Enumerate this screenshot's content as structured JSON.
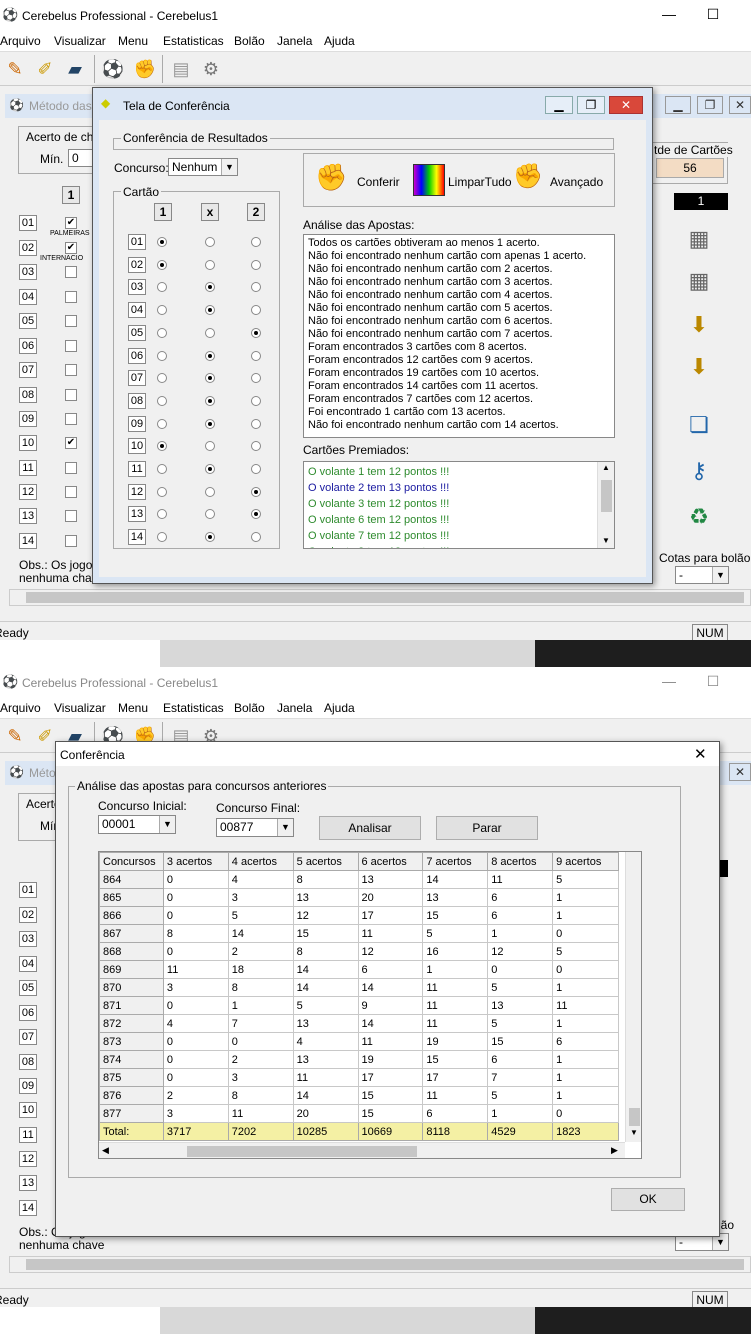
{
  "app": {
    "title": "Cerebelus Professional - Cerebelus1",
    "menu": [
      "Arquivo",
      "Visualizar",
      "Menu",
      "Estatisticas",
      "Bolão",
      "Janela",
      "Ajuda"
    ],
    "child_window_title": "Método das",
    "status_left": "Ready",
    "status_num": "NUM",
    "acerto_label": "Acerto de cha",
    "min_label": "Mín.",
    "min_value": "0",
    "qtde_cartoes_label": "tde de Cartões",
    "qtde_cartoes_value": "56",
    "black_box_value": "1",
    "cotas_label": "Cotas para bolão",
    "cotas_value": "-",
    "obs_line1": "Obs.: Os jogos",
    "obs_line2": "nenhuma chave",
    "col1": "1",
    "rows": [
      "01",
      "02",
      "03",
      "04",
      "05",
      "06",
      "07",
      "08",
      "09",
      "10",
      "11",
      "12",
      "13",
      "14"
    ],
    "team_labels": [
      "PALMEIRAS",
      "INTERNACIO"
    ]
  },
  "dialog1": {
    "title": "Tela de Conferência",
    "group_title": "Conferência de Resultados",
    "concurso_label": "Concurso:",
    "concurso_value": "Nenhum",
    "cartao_label": "Cartão",
    "col_headers": [
      "1",
      "x",
      "2"
    ],
    "rows": [
      "01",
      "02",
      "03",
      "04",
      "05",
      "06",
      "07",
      "08",
      "09",
      "10",
      "11",
      "12",
      "13",
      "14"
    ],
    "selections": [
      0,
      0,
      1,
      1,
      2,
      1,
      1,
      1,
      1,
      0,
      1,
      2,
      2,
      1
    ],
    "btn_conferir": "Conferir",
    "btn_limpar": "LimparTudo",
    "btn_avancado": "Avançado",
    "analise_label": "Análise das Apostas:",
    "analise_lines": [
      "Todos os cartões obtiveram ao menos 1 acerto.",
      "Não foi encontrado nenhum cartão com apenas 1 acerto.",
      "Não foi encontrado nenhum cartão com 2 acertos.",
      "Não foi encontrado nenhum cartão com 3 acertos.",
      "Não foi encontrado nenhum cartão com 4 acertos.",
      "Não foi encontrado nenhum cartão com 5 acertos.",
      "Não foi encontrado nenhum cartão com 6 acertos.",
      "Não foi encontrado nenhum cartão com 7 acertos.",
      "Foram encontrados 3 cartões com 8 acertos.",
      "Foram encontrados 12 cartões com 9 acertos.",
      "Foram encontrados 19 cartões com 10 acertos.",
      "Foram encontrados 14 cartões com 11 acertos.",
      "Foram encontrados 7 cartões com 12 acertos.",
      "Foi encontrado 1 cartão com 13 acertos.",
      "Não foi encontrado nenhum cartão com 14 acertos."
    ],
    "premiados_label": "Cartões Premiados:",
    "premiados": [
      {
        "text": "O volante 1 tem 12 pontos !!!",
        "color": "#2e8b2e"
      },
      {
        "text": "O volante 2 tem 13 pontos !!!",
        "color": "#1a1aa0"
      },
      {
        "text": "O volante 3 tem 12 pontos !!!",
        "color": "#2e8b2e"
      },
      {
        "text": "O volante 6 tem 12 pontos !!!",
        "color": "#2e8b2e"
      },
      {
        "text": "O volante 7 tem 12 pontos !!!",
        "color": "#2e8b2e"
      },
      {
        "text": "O volante 8 tem 12 pontos !!!",
        "color": "#2e8b2e"
      }
    ]
  },
  "dialog2": {
    "title": "Conferência",
    "close": "✕",
    "group_title": "Análise das apostas para concursos anteriores",
    "inicial_label": "Concurso Inicial:",
    "inicial_value": "00001",
    "final_label": "Concurso Final:",
    "final_value": "00877",
    "btn_analisar": "Analisar",
    "btn_parar": "Parar",
    "btn_ok": "OK",
    "columns": [
      "Concursos",
      "3 acertos",
      "4 acertos",
      "5 acertos",
      "6 acertos",
      "7 acertos",
      "8 acertos",
      "9 acertos"
    ],
    "rows": [
      [
        "864",
        "0",
        "4",
        "8",
        "13",
        "14",
        "11",
        "5"
      ],
      [
        "865",
        "0",
        "3",
        "13",
        "20",
        "13",
        "6",
        "1"
      ],
      [
        "866",
        "0",
        "5",
        "12",
        "17",
        "15",
        "6",
        "1"
      ],
      [
        "867",
        "8",
        "14",
        "15",
        "11",
        "5",
        "1",
        "0"
      ],
      [
        "868",
        "0",
        "2",
        "8",
        "12",
        "16",
        "12",
        "5"
      ],
      [
        "869",
        "11",
        "18",
        "14",
        "6",
        "1",
        "0",
        "0"
      ],
      [
        "870",
        "3",
        "8",
        "14",
        "14",
        "11",
        "5",
        "1"
      ],
      [
        "871",
        "0",
        "1",
        "5",
        "9",
        "11",
        "13",
        "11"
      ],
      [
        "872",
        "4",
        "7",
        "13",
        "14",
        "11",
        "5",
        "1"
      ],
      [
        "873",
        "0",
        "0",
        "4",
        "11",
        "19",
        "15",
        "6"
      ],
      [
        "874",
        "0",
        "2",
        "13",
        "19",
        "15",
        "6",
        "1"
      ],
      [
        "875",
        "0",
        "3",
        "11",
        "17",
        "17",
        "7",
        "1"
      ],
      [
        "876",
        "2",
        "8",
        "14",
        "15",
        "11",
        "5",
        "1"
      ],
      [
        "877",
        "3",
        "11",
        "20",
        "15",
        "6",
        "1",
        "0"
      ]
    ],
    "total": [
      "Total:",
      "3717",
      "7202",
      "10285",
      "10669",
      "8118",
      "4529",
      "1823"
    ]
  }
}
